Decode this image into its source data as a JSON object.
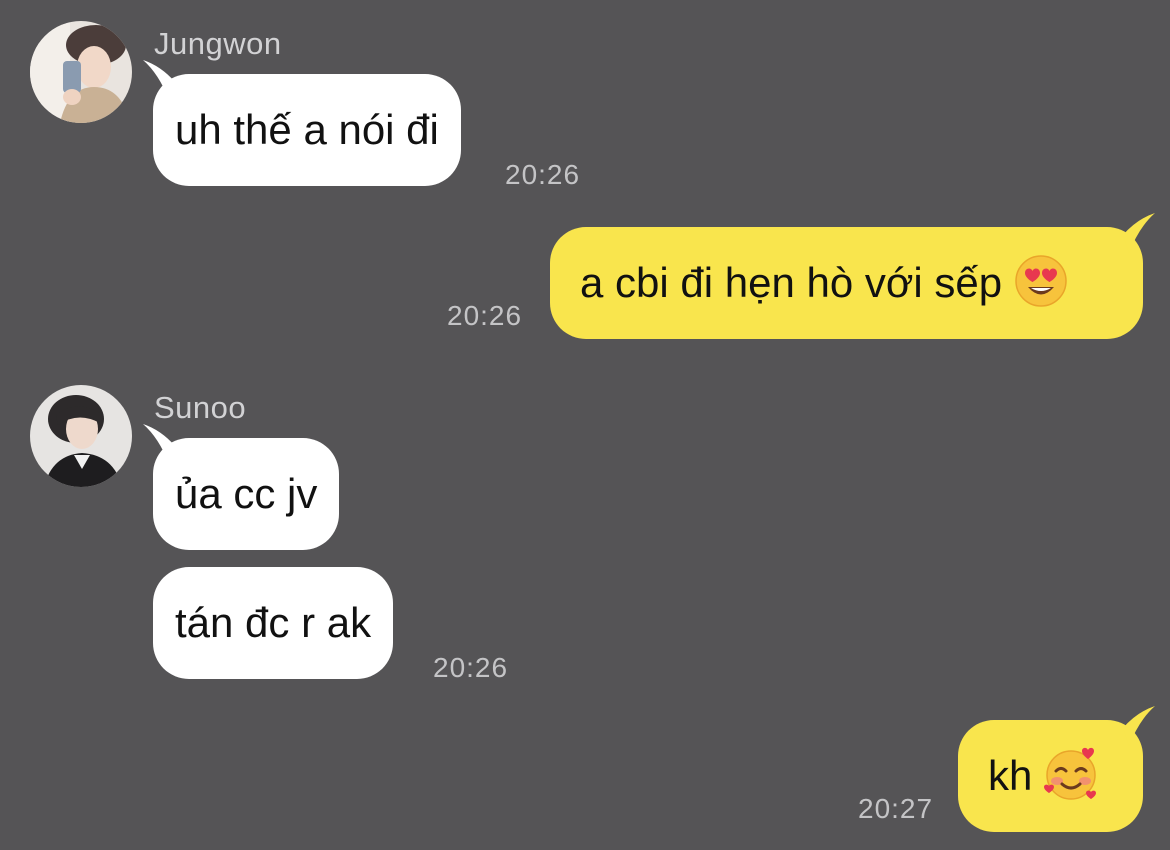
{
  "messages": [
    {
      "sender": "Jungwon",
      "text": "uh thế a nói đi",
      "time": "20:26"
    },
    {
      "text": "a cbi đi hẹn hò với sếp",
      "emoji": "smiling-face-with-heart-eyes-emoji",
      "time": "20:26"
    },
    {
      "sender": "Sunoo",
      "text": "ủa cc jv"
    },
    {
      "text": "tán đc r ak",
      "time": "20:26"
    },
    {
      "text": "kh",
      "emoji": "smiling-face-with-hearts-emoji",
      "time": "20:27"
    }
  ],
  "colors": {
    "background": "#555456",
    "incoming_bubble": "#ffffff",
    "outgoing_bubble": "#f9e54d",
    "sender_text": "#d2d2d4",
    "timestamp_text": "#c4c4c6"
  }
}
